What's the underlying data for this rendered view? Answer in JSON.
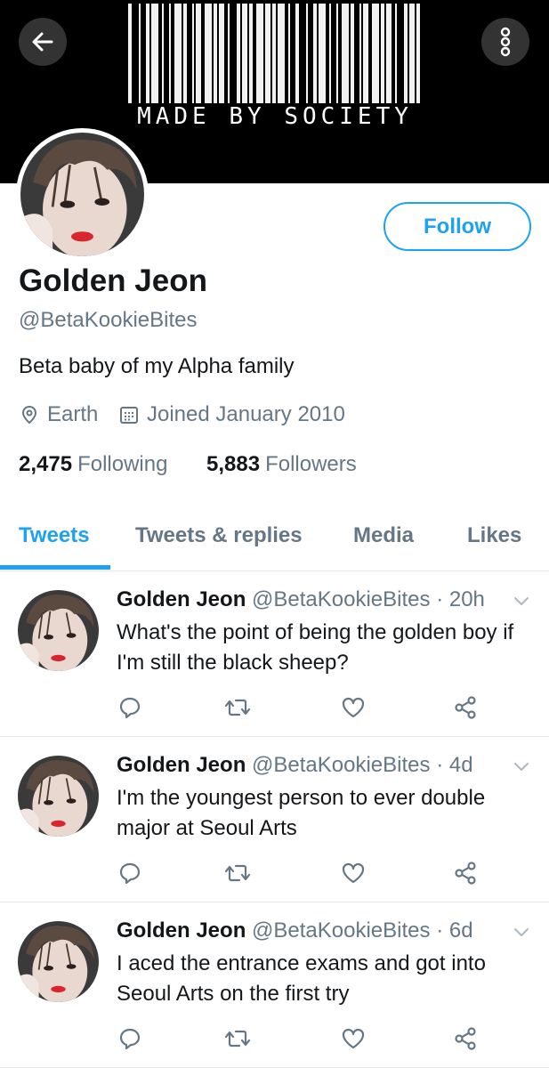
{
  "header": {
    "banner_text": "MADE BY SOCIETY",
    "back_icon": "arrow-left-icon",
    "more_icon": "more-vertical-icon"
  },
  "profile": {
    "follow_label": "Follow",
    "name": "Golden Jeon",
    "handle": "@BetaKookieBites",
    "bio": "Beta baby of my Alpha family",
    "location": "Earth",
    "joined": "Joined January 2010",
    "following_count": "2,475",
    "following_label": "Following",
    "followers_count": "5,883",
    "followers_label": "Followers"
  },
  "tabs": [
    {
      "label": "Tweets",
      "active": true
    },
    {
      "label": "Tweets & replies",
      "active": false
    },
    {
      "label": "Media",
      "active": false
    },
    {
      "label": "Likes",
      "active": false
    }
  ],
  "tweets": [
    {
      "name": "Golden Jeon",
      "handle": "@BetaKookieBites",
      "time": "· 20h",
      "text": "What's the point of being the golden boy if I'm still the black sheep?"
    },
    {
      "name": "Golden Jeon",
      "handle": "@BetaKookieBites",
      "time": "· 4d",
      "text": "I'm the youngest person to ever double major at Seoul Arts"
    },
    {
      "name": "Golden Jeon",
      "handle": "@BetaKookieBites",
      "time": "· 6d",
      "text": "I aced the entrance exams and got into Seoul Arts on the first try"
    }
  ],
  "colors": {
    "accent": "#1da1f2",
    "secondary_text": "#657786",
    "primary_text": "#14171a"
  }
}
